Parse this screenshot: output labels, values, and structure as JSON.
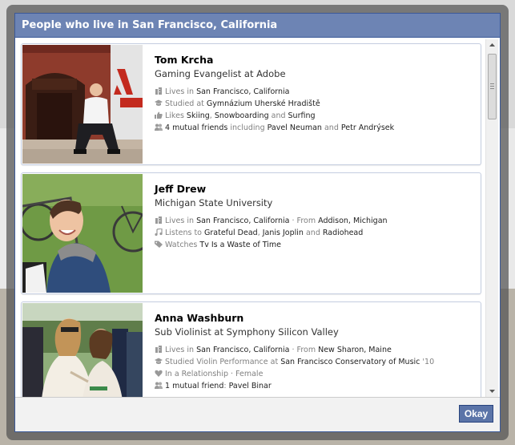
{
  "dialog": {
    "title": "People who live in San Francisco, California",
    "okay_label": "Okay"
  },
  "people": [
    {
      "name": "Tom Krcha",
      "subtitle": "Gaming Evangelist at Adobe",
      "details": [
        {
          "icon": "building-icon",
          "parts": [
            {
              "t": "Lives in "
            },
            {
              "t": "San Francisco, California",
              "hl": true
            }
          ]
        },
        {
          "icon": "graduation-cap-icon",
          "parts": [
            {
              "t": "Studied at "
            },
            {
              "t": "Gymnázium Uherské Hradiště",
              "hl": true
            }
          ]
        },
        {
          "icon": "thumbs-up-icon",
          "parts": [
            {
              "t": "Likes "
            },
            {
              "t": "Skiing",
              "hl": true
            },
            {
              "t": ", "
            },
            {
              "t": "Snowboarding",
              "hl": true
            },
            {
              "t": " and "
            },
            {
              "t": "Surfing",
              "hl": true
            }
          ]
        },
        {
          "icon": "friends-icon",
          "parts": [
            {
              "t": "4 mutual friends",
              "hl": true
            },
            {
              "t": " including "
            },
            {
              "t": "Pavel Neuman",
              "hl": true
            },
            {
              "t": " and "
            },
            {
              "t": "Petr Andrýsek",
              "hl": true
            }
          ]
        }
      ]
    },
    {
      "name": "Jeff Drew",
      "subtitle": "Michigan State University",
      "details": [
        {
          "icon": "building-icon",
          "parts": [
            {
              "t": "Lives in "
            },
            {
              "t": "San Francisco, California",
              "hl": true
            },
            {
              "t": " · From "
            },
            {
              "t": "Addison, Michigan",
              "hl": true
            }
          ]
        },
        {
          "icon": "music-note-icon",
          "parts": [
            {
              "t": "Listens to "
            },
            {
              "t": "Grateful Dead",
              "hl": true
            },
            {
              "t": ", "
            },
            {
              "t": "Janis Joplin",
              "hl": true
            },
            {
              "t": " and "
            },
            {
              "t": "Radiohead",
              "hl": true
            }
          ]
        },
        {
          "icon": "tag-icon",
          "parts": [
            {
              "t": "Watches "
            },
            {
              "t": "Tv Is a Waste of Time",
              "hl": true
            }
          ]
        }
      ]
    },
    {
      "name": "Anna Washburn",
      "subtitle": "Sub Violinist at Symphony Silicon Valley",
      "details": [
        {
          "icon": "building-icon",
          "parts": [
            {
              "t": "Lives in "
            },
            {
              "t": "San Francisco, California",
              "hl": true
            },
            {
              "t": " · From "
            },
            {
              "t": "New Sharon, Maine",
              "hl": true
            }
          ]
        },
        {
          "icon": "graduation-cap-icon",
          "parts": [
            {
              "t": "Studied Violin Performance at "
            },
            {
              "t": "San Francisco Conservatory of Music",
              "hl": true
            },
            {
              "t": " '10"
            }
          ]
        },
        {
          "icon": "heart-icon",
          "parts": [
            {
              "t": "In a Relationship · Female"
            }
          ]
        },
        {
          "icon": "friends-icon",
          "parts": [
            {
              "t": "1 mutual friend",
              "hl": true
            },
            {
              "t": ": "
            },
            {
              "t": "Pavel Binar",
              "hl": true
            }
          ]
        }
      ]
    }
  ]
}
